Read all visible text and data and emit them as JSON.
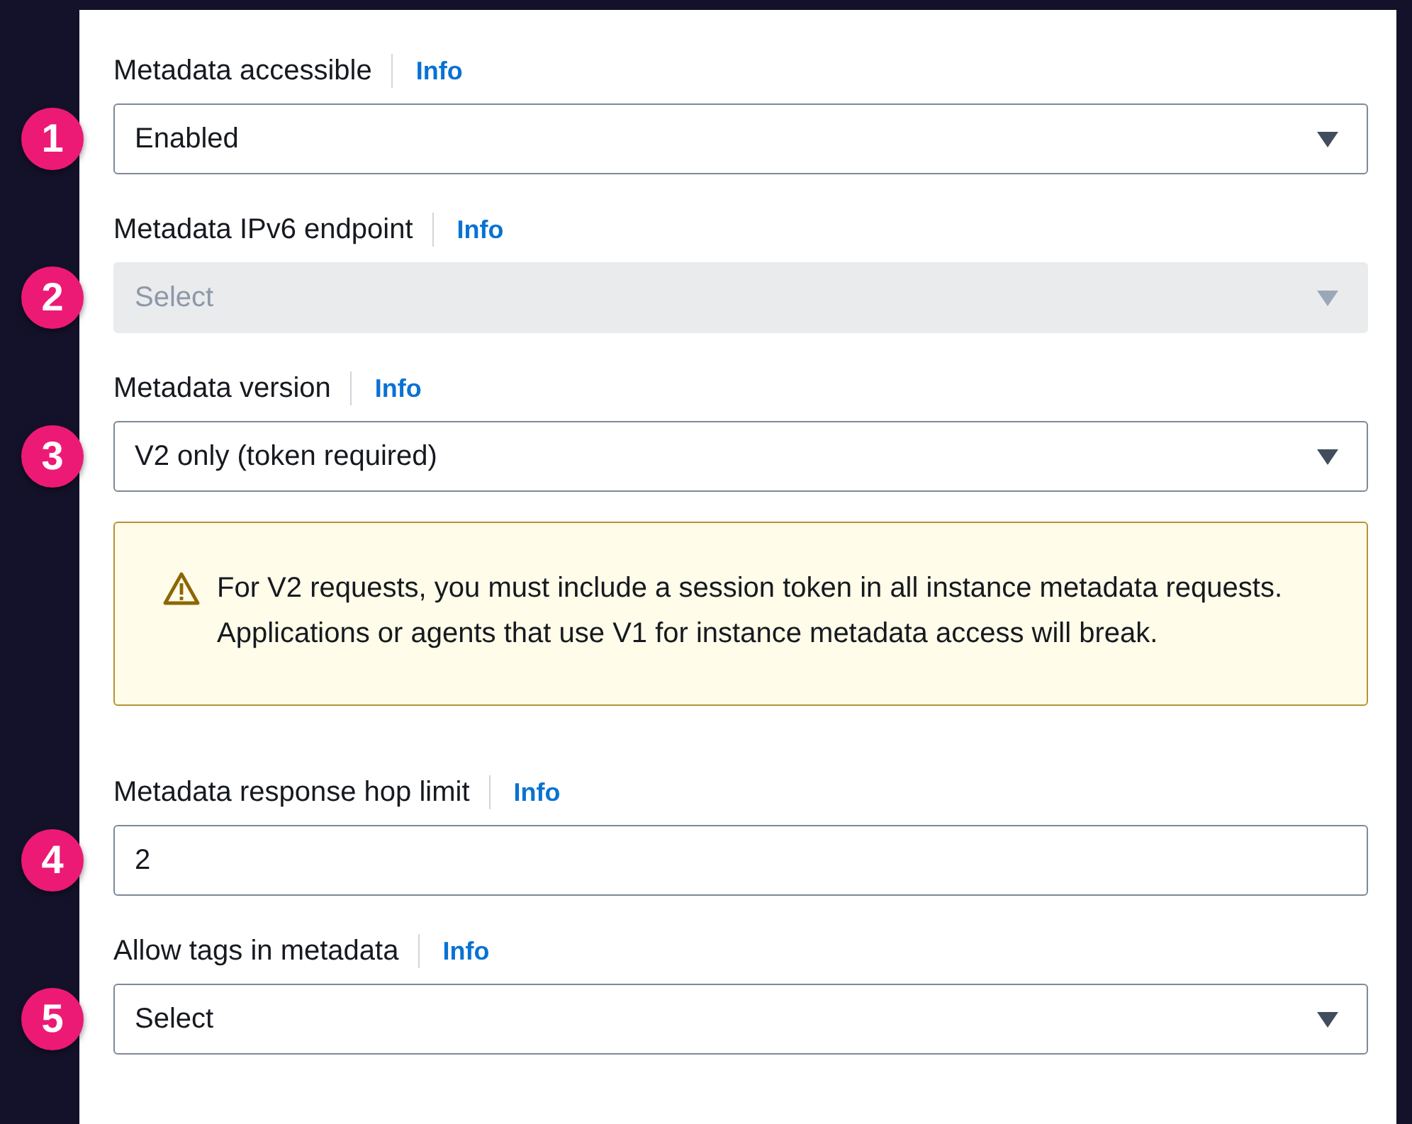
{
  "fields": [
    {
      "kind": "select",
      "badge": "1",
      "label": "Metadata accessible",
      "info": "Info",
      "value": "Enabled",
      "disabled": false
    },
    {
      "kind": "select",
      "badge": "2",
      "label": "Metadata IPv6 endpoint",
      "info": "Info",
      "value": "Select",
      "disabled": true
    },
    {
      "kind": "select",
      "badge": "3",
      "label": "Metadata version",
      "info": "Info",
      "value": "V2 only (token required)",
      "disabled": false
    },
    {
      "kind": "alert",
      "text": "For V2 requests, you must include a session token in all instance metadata requests. Applications or agents that use V1 for instance metadata access will break."
    },
    {
      "kind": "input",
      "badge": "4",
      "label": "Metadata response hop limit",
      "info": "Info",
      "value": "2",
      "disabled": false
    },
    {
      "kind": "select",
      "badge": "5",
      "label": "Allow tags in metadata",
      "info": "Info",
      "value": "Select",
      "disabled": false
    }
  ]
}
